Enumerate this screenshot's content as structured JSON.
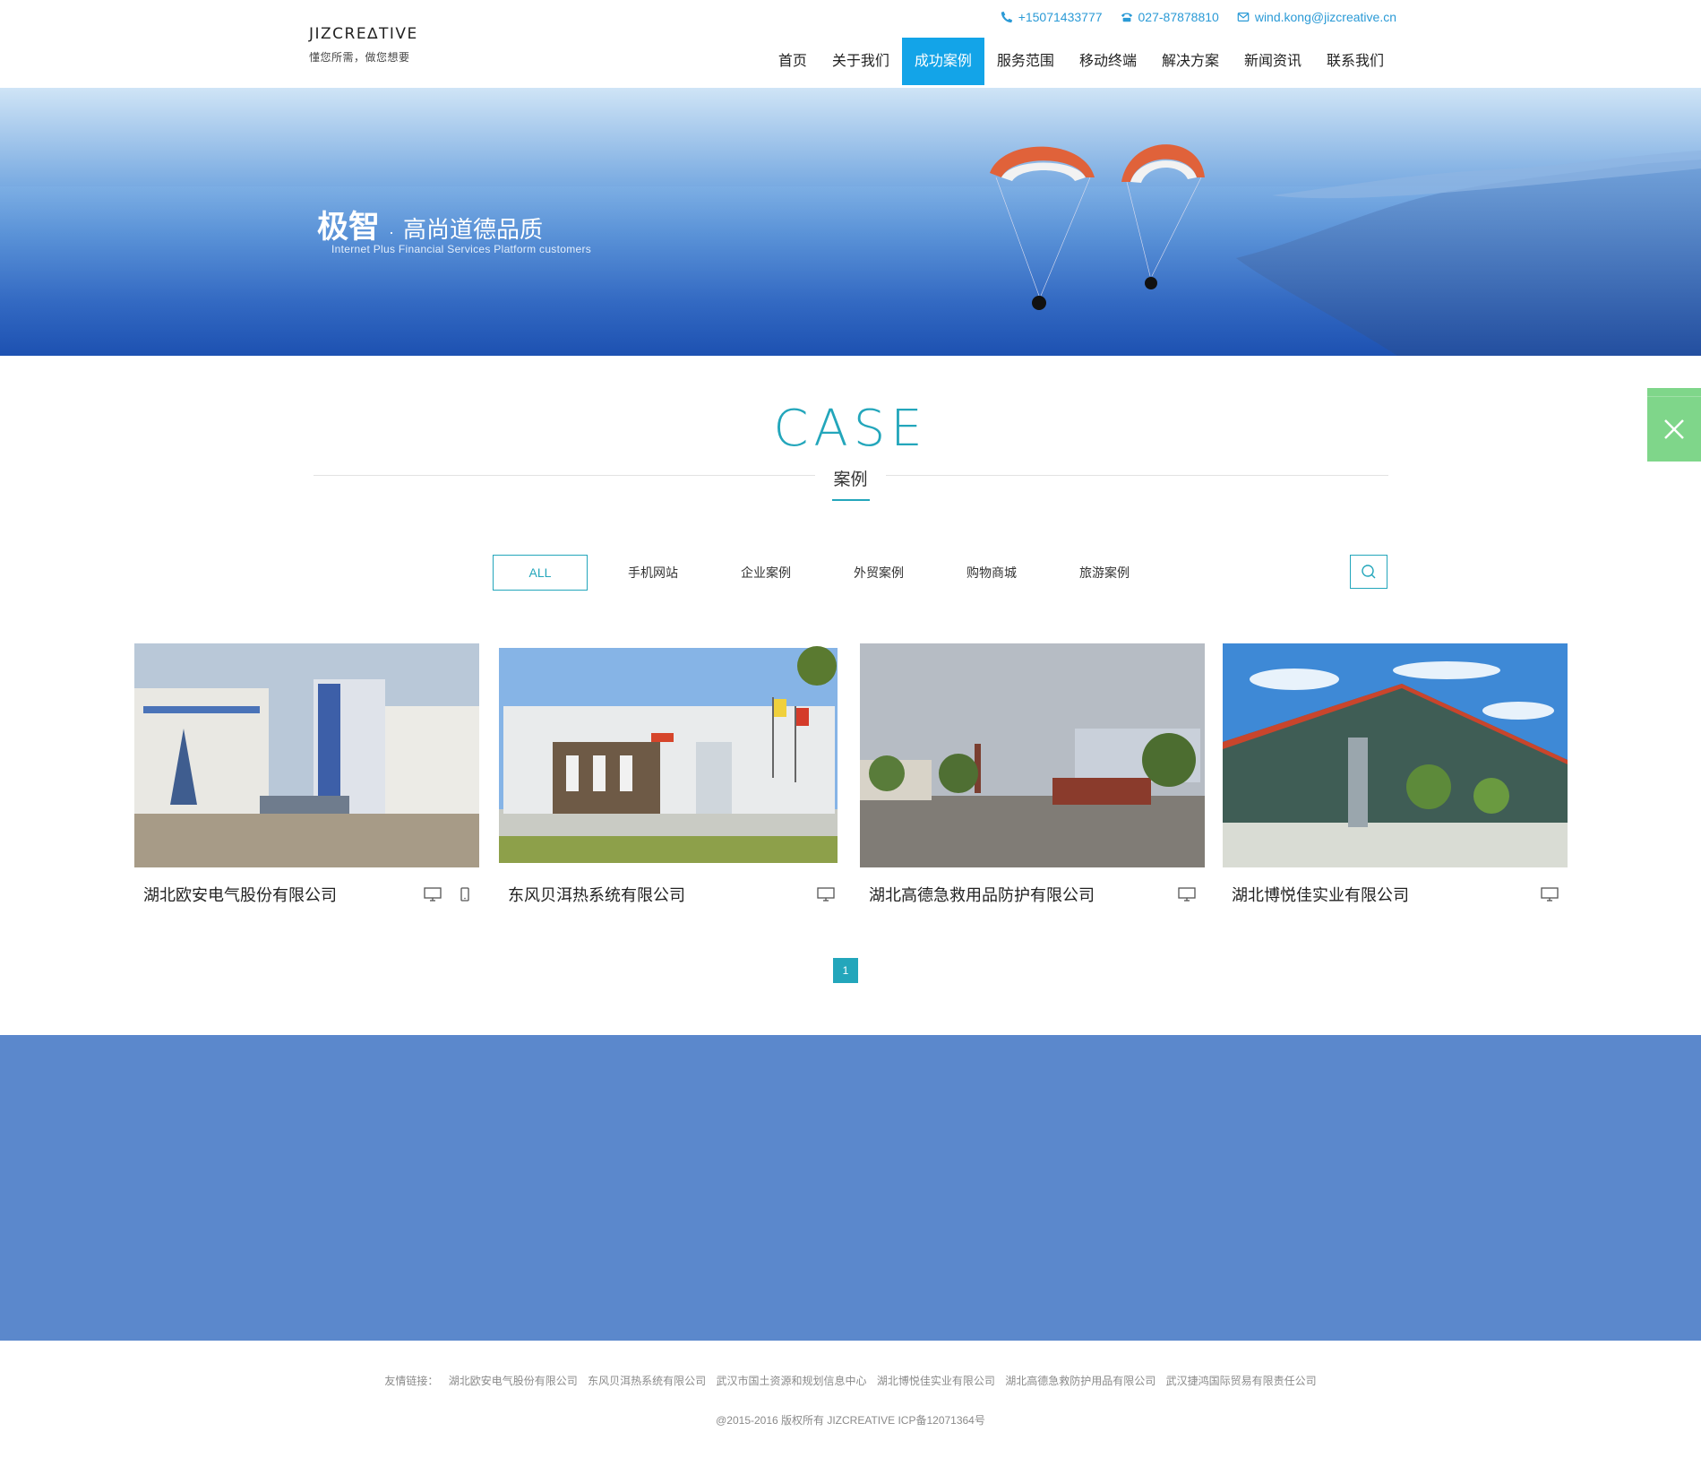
{
  "header": {
    "logo_text": "JIZCRE∆TIVE",
    "logo_tagline": "懂您所需，做您想要",
    "phone_mobile": "+15071433777",
    "phone_office": "027-87878810",
    "email": "wind.kong@jizcreative.cn",
    "nav": [
      {
        "label": "首页",
        "active": false
      },
      {
        "label": "关于我们",
        "active": false
      },
      {
        "label": "成功案例",
        "active": true
      },
      {
        "label": "服务范围",
        "active": false
      },
      {
        "label": "移动终端",
        "active": false
      },
      {
        "label": "解决方案",
        "active": false
      },
      {
        "label": "新闻资讯",
        "active": false
      },
      {
        "label": "联系我们",
        "active": false
      }
    ]
  },
  "banner": {
    "title_main": "极智",
    "title_dot": "·",
    "title_sub": "高尚道德品质",
    "subtitle_en": "Internet Plus Financial Services Platform customers"
  },
  "section": {
    "title_en": "CASE",
    "title_cn": "案例"
  },
  "filters": [
    {
      "label": "ALL",
      "active": true
    },
    {
      "label": "手机网站",
      "active": false
    },
    {
      "label": "企业案例",
      "active": false
    },
    {
      "label": "外贸案例",
      "active": false
    },
    {
      "label": "购物商城",
      "active": false
    },
    {
      "label": "旅游案例",
      "active": false
    }
  ],
  "cases": [
    {
      "name": "湖北欧安电气股份有限公司",
      "pc": true,
      "mobile": true
    },
    {
      "name": "东风贝洱热系统有限公司",
      "pc": true,
      "mobile": false
    },
    {
      "name": "湖北高德急救用品防护有限公司",
      "pc": true,
      "mobile": false
    },
    {
      "name": "湖北博悦佳实业有限公司",
      "pc": true,
      "mobile": false
    }
  ],
  "pagination": {
    "current": "1"
  },
  "footer": {
    "links_label": "友情链接：",
    "links": [
      "湖北欧安电气股份有限公司",
      "东风贝洱热系统有限公司",
      "武汉市国土资源和规划信息中心",
      "湖北博悦佳实业有限公司",
      "湖北高德急救防护用品有限公司",
      "武汉捷鸿国际贸易有限责任公司"
    ],
    "copyright": "@2015-2016 版权所有 JIZCREATIVE ICP备12071364号"
  },
  "colors": {
    "accent": "#23a6bb",
    "nav_active": "#13a4e8",
    "contact_blue": "#2a9ad6",
    "band": "#5b88cc",
    "side_widget": "#7fd68a"
  }
}
